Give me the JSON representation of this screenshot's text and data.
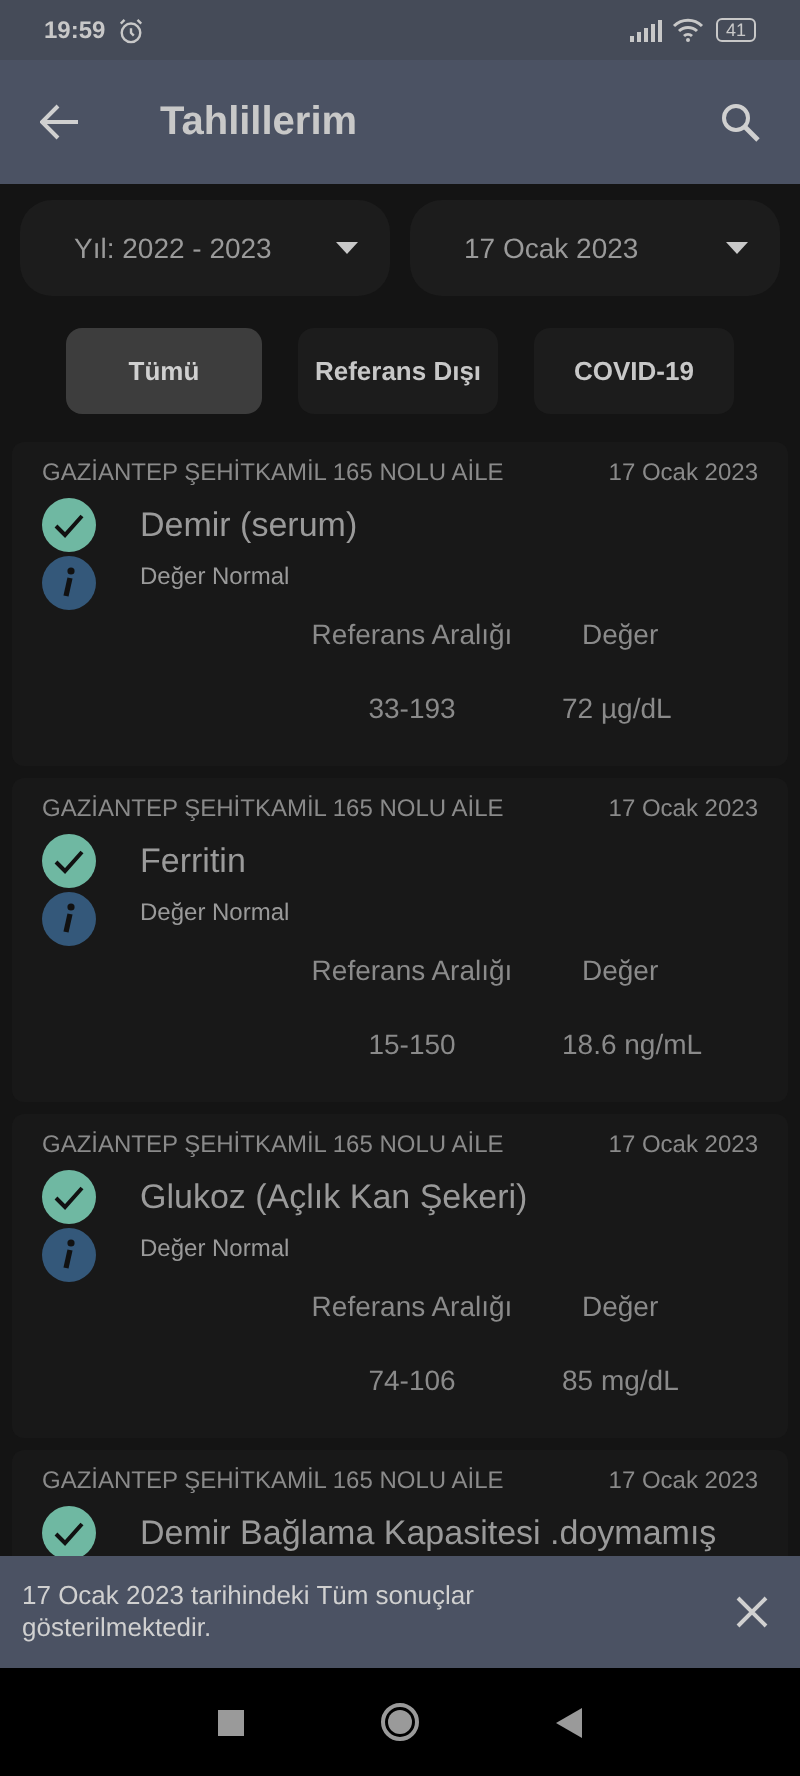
{
  "status_bar": {
    "time": "19:59",
    "battery": "41"
  },
  "app_bar": {
    "title": "Tahlillerim"
  },
  "filters": [
    {
      "value": "Yıl: 2022 - 2023"
    },
    {
      "value": "17 Ocak 2023"
    }
  ],
  "tabs": [
    {
      "label": "Tümü",
      "selected": true
    },
    {
      "label": "Referans Dışı",
      "selected": false
    },
    {
      "label": "COVID-19",
      "selected": false
    }
  ],
  "results": [
    {
      "facility": "GAZİANTEP ŞEHİTKAMİL 165 NOLU AİLE",
      "date": "17 Ocak 2023",
      "test": "Demir (serum)",
      "normal": true,
      "status": "Değer Normal",
      "range_label": "Referans Aralığı",
      "value_label": "Değer",
      "range": "33-193",
      "value": "72 µg/dL"
    },
    {
      "facility": "GAZİANTEP ŞEHİTKAMİL 165 NOLU AİLE",
      "date": "17 Ocak 2023",
      "test": "Ferritin",
      "normal": true,
      "status": "Değer Normal",
      "range_label": "Referans Aralığı",
      "value_label": "Değer",
      "range": "15-150",
      "value": "18.6 ng/mL"
    },
    {
      "facility": "GAZİANTEP ŞEHİTKAMİL 165 NOLU AİLE",
      "date": "17 Ocak 2023",
      "test": "Glukoz (Açlık Kan Şekeri)",
      "normal": true,
      "status": "Değer Normal",
      "range_label": "Referans Aralığı",
      "value_label": "Değer",
      "range": "74-106",
      "value": "85 mg/dL"
    },
    {
      "facility": "GAZİANTEP ŞEHİTKAMİL 165 NOLU AİLE",
      "date": "17 Ocak 2023",
      "test": "Demir Bağlama Kapasitesi .doymamış",
      "normal": true
    }
  ],
  "snackbar": {
    "message": "17 Ocak 2023 tarihindeki Tüm sonuçlar gösterilmektedir."
  }
}
